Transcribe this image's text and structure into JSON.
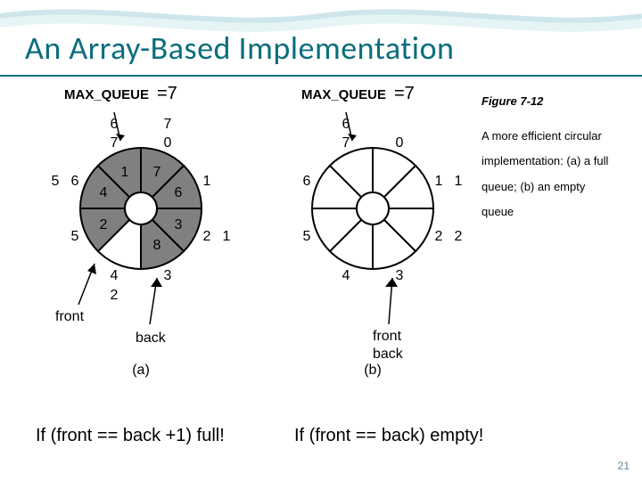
{
  "title": "An Array-Based Implementation",
  "max_queue_label": "MAX_QUEUE",
  "max_queue_value": "=7",
  "caption": {
    "figure": "Figure 7-12",
    "line1": "A more efficient circular",
    "line2": "implementation: (a) a full",
    "line3": "queue; (b) an empty",
    "line4": "queue"
  },
  "chart_data": [
    {
      "type": "pie",
      "id": "a",
      "label": "(a)",
      "max_queue": 7,
      "slices": [
        {
          "index": 0,
          "value": 7,
          "filled": true
        },
        {
          "index": 1,
          "value": 6,
          "filled": true
        },
        {
          "index": 2,
          "value": 3,
          "filled": true
        },
        {
          "index": 3,
          "value": 8,
          "filled": true
        },
        {
          "index": 4,
          "value": null,
          "filled": false
        },
        {
          "index": 5,
          "value": 2,
          "filled": true
        },
        {
          "index": 6,
          "value": 4,
          "filled": true
        },
        {
          "index": 7,
          "value": 1,
          "filled": true
        }
      ],
      "outer_labels": {
        "0": 7,
        "2": 1,
        "4": 2,
        "6": 5,
        "7": 6
      },
      "pointers": {
        "front": 5,
        "back": 3
      }
    },
    {
      "type": "pie",
      "id": "b",
      "label": "(b)",
      "max_queue": 7,
      "slices": [
        {
          "index": 0,
          "value": null,
          "filled": false
        },
        {
          "index": 1,
          "value": null,
          "filled": false
        },
        {
          "index": 2,
          "value": null,
          "filled": false
        },
        {
          "index": 3,
          "value": null,
          "filled": false
        },
        {
          "index": 4,
          "value": null,
          "filled": false
        },
        {
          "index": 5,
          "value": null,
          "filled": false
        },
        {
          "index": 6,
          "value": null,
          "filled": false
        },
        {
          "index": 7,
          "value": null,
          "filled": false
        }
      ],
      "outer_labels": {
        "1": 1,
        "3": 2,
        "7": 6
      },
      "pointers": {
        "front": 3,
        "back": 3
      }
    }
  ],
  "labels": {
    "front": "front",
    "back": "back"
  },
  "conditions": {
    "a": "If (front == back +1) full!",
    "b": "If (front == back) empty!"
  },
  "page_number": "21"
}
